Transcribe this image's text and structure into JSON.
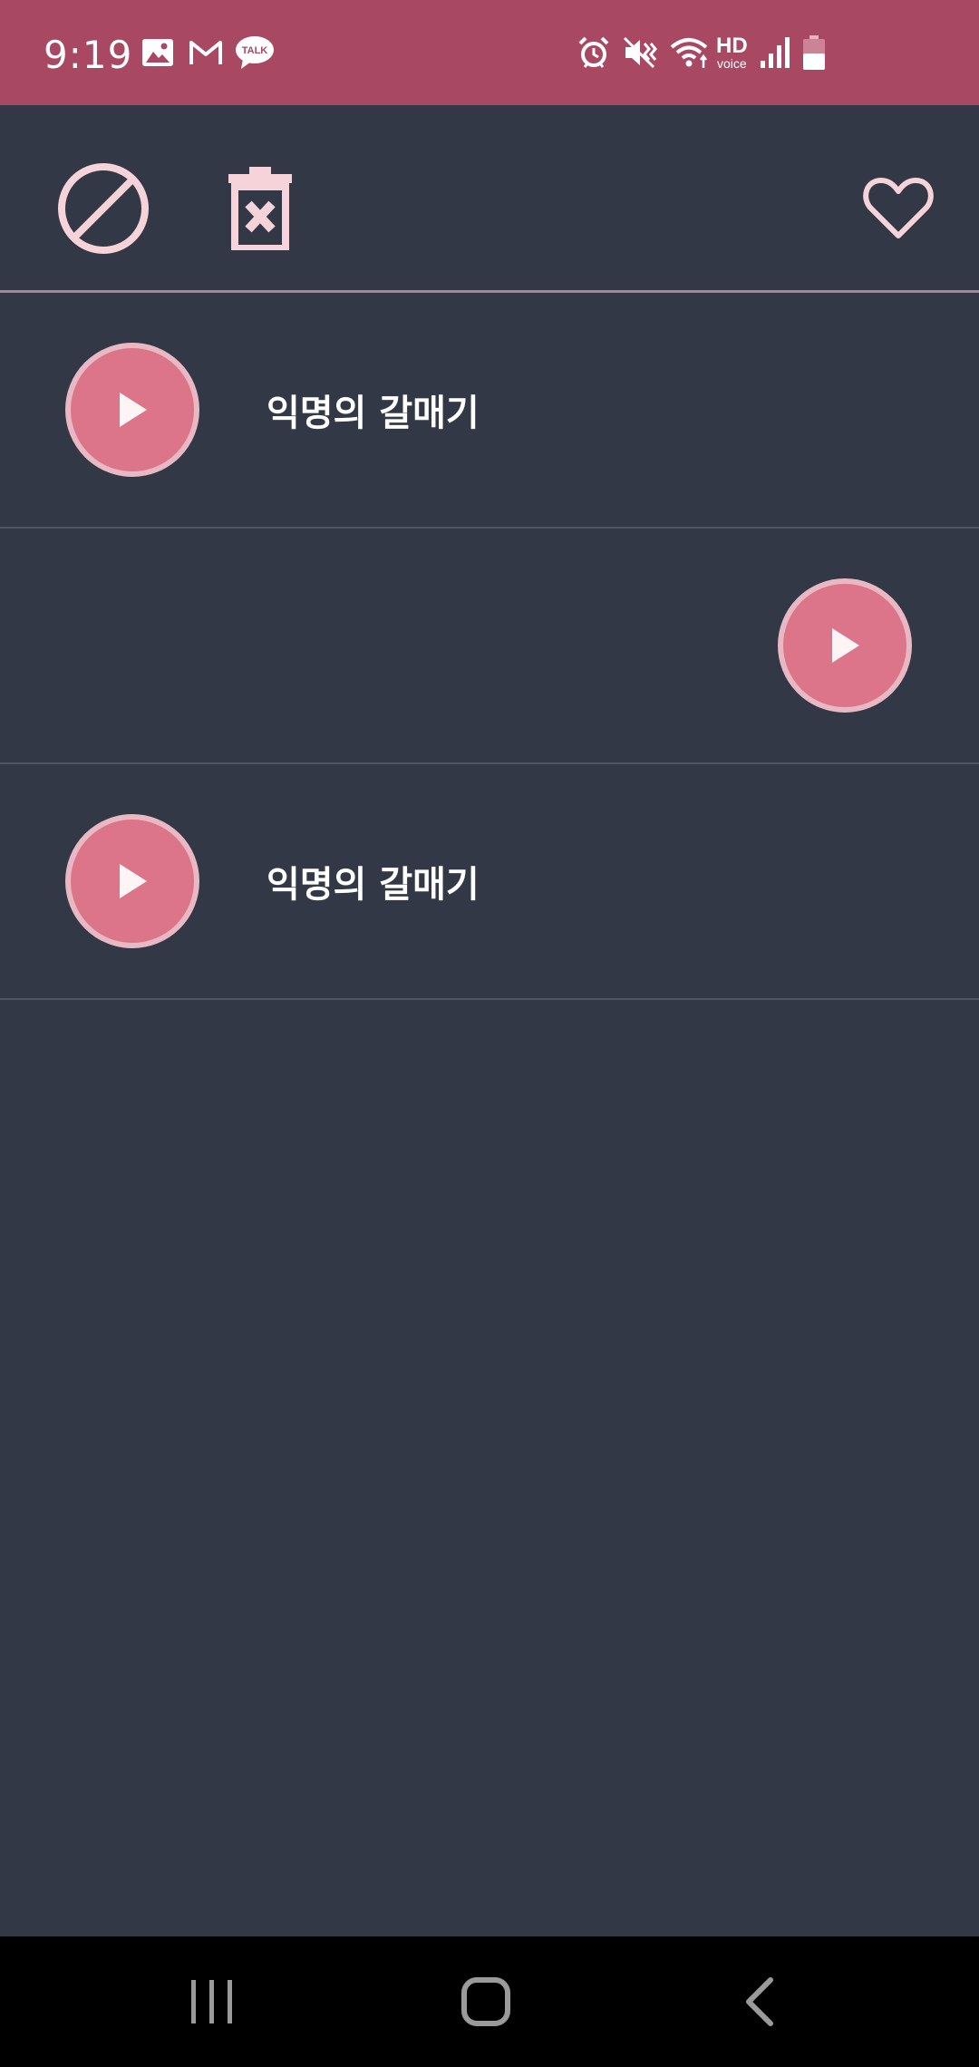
{
  "status_bar": {
    "time": "9:19",
    "notification_icons": [
      "gallery-icon",
      "gmail-icon",
      "kakaotalk-icon"
    ],
    "kakaotalk_label": "TALK",
    "system_icons": [
      "alarm-icon",
      "vibrate-icon",
      "wifi-icon",
      "hd-voice-icon",
      "signal-icon",
      "battery-icon"
    ],
    "hd_label": "HD",
    "voice_label": "voice",
    "bg_color": "#a94863"
  },
  "toolbar": {
    "buttons": [
      "block-icon",
      "delete-icon",
      "favorite-icon"
    ],
    "icon_color": "#f5d3d9"
  },
  "list": {
    "items": [
      {
        "title": "익명의 갈매기",
        "align": "left"
      },
      {
        "title": "",
        "align": "right"
      },
      {
        "title": "익명의 갈매기",
        "align": "left"
      }
    ]
  },
  "colors": {
    "background": "#323846",
    "accent": "#dc7589",
    "accent_border": "#e9b9c3"
  },
  "nav_bar": {
    "buttons": [
      "recent-apps-icon",
      "home-icon",
      "back-icon"
    ]
  }
}
